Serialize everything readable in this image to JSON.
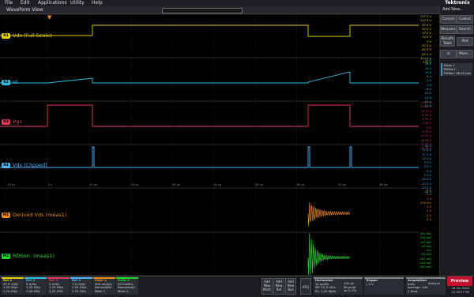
{
  "menu": [
    "File",
    "Edit",
    "Applications",
    "Utility",
    "Help"
  ],
  "brand": "Tektronix",
  "window_title": "Waveform View",
  "colors": {
    "vds": "#e8d200",
    "id": "#33bfe6",
    "vgs": "#e23a5a",
    "vds_clipped": "#4db8ff",
    "derived": "#f08a1c",
    "rdson": "#22d62a",
    "grid": "#2b2b2b",
    "accent": "#2e9bd3"
  },
  "channels": [
    {
      "badge": "R1",
      "name": "Vds (Full Scale)",
      "scale": [
        "137.5 V",
        "112.5 V",
        "87.5 V",
        "62.5 V",
        "37.5 V",
        "12.5 V",
        "0 V",
        "-37.5 V",
        "-62.5 V",
        "-87.5 V",
        "-112.5 V",
        "-135 V"
      ]
    },
    {
      "badge": "R2",
      "name": "Id",
      "scale": [
        "22 A",
        "18 A",
        "14 A",
        "10 A",
        "6 A",
        "2 A",
        "-2 A",
        "-6 A",
        "-10 A",
        "-14 A",
        "-18 A",
        "-22 A"
      ]
    },
    {
      "badge": "R3",
      "name": "Vgs",
      "scale": [
        "13.7 V",
        "11.25 V",
        "8.75 V",
        "6.25 V",
        "3.75 V",
        "1.25 V",
        "0 V",
        "-3.75 V",
        "-6.25 V",
        "-8.75 V",
        "-11.25 V",
        "-13.75 V"
      ]
    },
    {
      "badge": "R4",
      "name": "Vds (Clipped)",
      "scale": [
        "30 V",
        "22.5 V",
        "17.5 V",
        "12.5 V",
        "7.5 V",
        "2.5 V",
        "0 V",
        "-7.5 V",
        "-12.5 V",
        "-17.5 V",
        "-22.5 V",
        "-30 V"
      ]
    },
    {
      "badge": "M1",
      "name": "Derived Vds (meas1)",
      "scale": [
        "3 V",
        "2 V",
        "1 V",
        "500 mV",
        "0 V",
        "-1 V",
        "-2 V",
        "-3 V"
      ]
    },
    {
      "badge": "M2",
      "name": "RDSon: (meas1)",
      "scale": [
        "200 mΩ",
        "150 mΩ",
        "100 mΩ",
        "50 mΩ",
        "0 Ω",
        "-50 mΩ",
        "-100 mΩ",
        "-150 mΩ",
        "-200 mΩ"
      ]
    }
  ],
  "time_axis": [
    "-10 µs",
    "0 s",
    "10 µs",
    "20 µs",
    "30 µs",
    "40 µs",
    "50 µs",
    "60 µs",
    "70 µs",
    "80 µs"
  ],
  "right_panel": {
    "add_new": "Add New...",
    "buttons": [
      "Cursors",
      "Callout",
      "Measure",
      "Search",
      "Results Table",
      "Plot",
      "More..."
    ],
    "meas_title": "Meas 1",
    "meas_lines": [
      "RDSon*",
      "RDSon: 38.20 mΩ"
    ]
  },
  "bottom": {
    "ref_boxes": [
      {
        "title": "Ref 1",
        "lines": [
          "37.5 V/div",
          "1.25 GS/s",
          "1.25 GSA",
          "5M:000_r"
        ]
      },
      {
        "title": "Ref 2",
        "lines": [
          "5 A/div",
          "1.25 GS/s",
          "1.25 GSA",
          "5M:000_r"
        ]
      },
      {
        "title": "Ref 3",
        "lines": [
          "5 V/div",
          "1.25 GS/s",
          "1.25 GSA",
          "5M:000_r"
        ]
      },
      {
        "title": "Ref 4",
        "lines": [
          "7.5 V/div",
          "1.25 GS/s",
          "1.25 GSA",
          "5M:000_r"
        ]
      },
      {
        "title": "Math 1",
        "lines": [
          "500 mV/div",
          "Derived(R4",
          "Math 1"
        ]
      },
      {
        "title": "Math 2",
        "lines": [
          "50 mΩ/div",
          "Removed(0.",
          "Meas 1"
        ]
      }
    ],
    "add_buttons": [
      "Add New Math",
      "Add New Ref",
      "Add New Bus"
    ],
    "afg": "AFG",
    "horizontal": {
      "title": "Horizontal",
      "lines": [
        "10 µs/div",
        "SR: 12.5 GS/s",
        "RL: 1.25 Mpts"
      ],
      "right": [
        "100 µs",
        "80 ps/pt",
        "◄ 11.4%"
      ]
    },
    "trigger": {
      "title": "Trigger",
      "lines": [
        "┐ 0 V"
      ]
    },
    "acquisition": {
      "title": "Acquisition",
      "lines": [
        "Auto,",
        "Average: 100",
        "1 Acqs"
      ],
      "right": [
        "Analyze"
      ]
    },
    "preview": "Preview",
    "date": [
      "16 Oct 2020",
      "12:39:27 PM"
    ]
  }
}
